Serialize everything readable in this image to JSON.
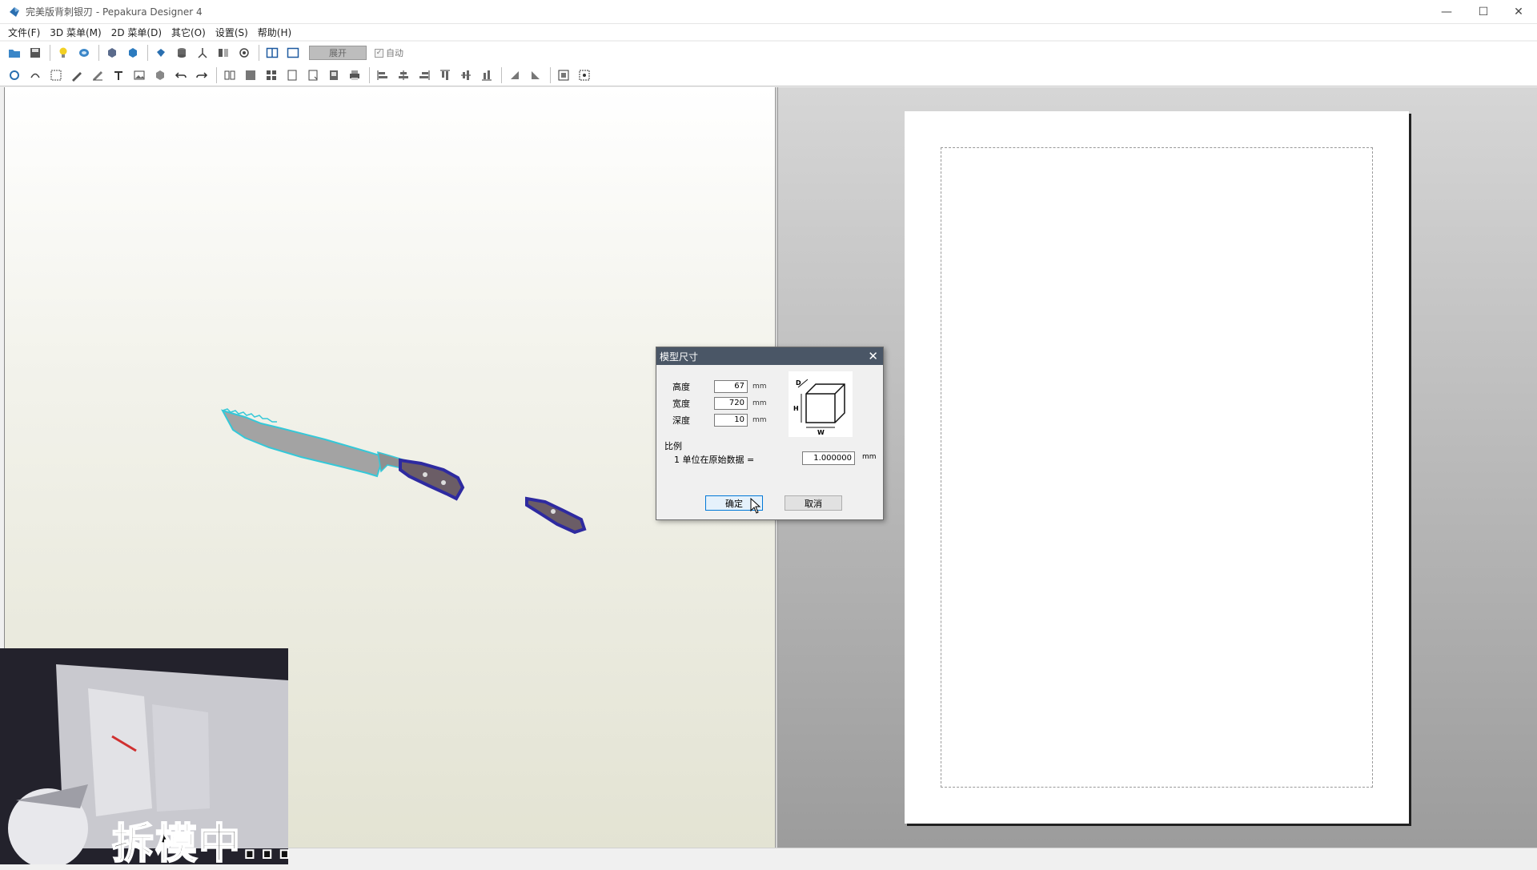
{
  "window": {
    "title": "完美版背刺银刃 - Pepakura Designer 4",
    "controls": {
      "minimize": "—",
      "maximize": "☐",
      "close": "✕"
    }
  },
  "menu": [
    "文件(F)",
    "3D 菜单(M)",
    "2D 菜单(D)",
    "其它(O)",
    "设置(S)",
    "帮助(H)"
  ],
  "toolbar": {
    "unfold_label": "展开",
    "auto_label": "自动",
    "auto_checked": true
  },
  "dialog": {
    "title": "模型尺寸",
    "height_label": "高度",
    "height_value": "67",
    "width_label": "宽度",
    "width_value": "720",
    "depth_label": "深度",
    "depth_value": "10",
    "unit": "mm",
    "scale_label": "比例",
    "unit_text": "1 单位在原始数据 =",
    "scale_value": "1.000000",
    "ok_label": "确定",
    "cancel_label": "取消",
    "diagram_labels": {
      "d": "D",
      "h": "H",
      "w": "W"
    }
  },
  "overlay": {
    "caption": "拆模中..."
  },
  "colors": {
    "model_outline": "#35c8d8",
    "handle": "#2e2aa0",
    "blade": "#9a9a9a"
  }
}
